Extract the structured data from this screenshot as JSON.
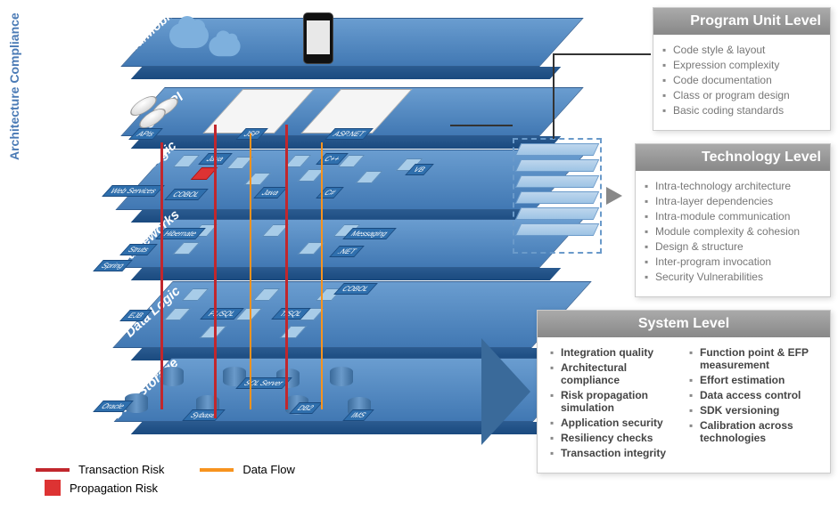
{
  "sideLabel": "Architecture Compliance",
  "layers": {
    "cloud": "Cloud/Mobile",
    "ui": "UI / API",
    "business": "Business Logic",
    "frameworks": "Frameworks",
    "datalogic": "Data Logic",
    "storage": "Data Storage"
  },
  "uiTech": {
    "apis": "APIs",
    "jsp": "JSP",
    "asp": "ASP.NET"
  },
  "businessTech": {
    "java_top": "Java",
    "cpp": "C++",
    "vb": "VB",
    "web": "Web Services",
    "cobol": "COBOL",
    "java2": "Java",
    "cs": "C#"
  },
  "frameworksTech": {
    "hibernate": "Hibernate",
    "messaging": "Messaging",
    "struts": "Struts",
    "net": ".NET",
    "spring": "Spring"
  },
  "dataLogicTech": {
    "cobol": "COBOL",
    "ejb": "EJB",
    "plsql": "PL/SQL",
    "tsql": "T/SQL"
  },
  "storageTech": {
    "oracle": "Oracle",
    "sqlserver": "SQL Server",
    "sybase": "Sybase",
    "db2": "DB2",
    "ims": "IMS"
  },
  "legend": {
    "transaction": "Transaction Risk",
    "dataflow": "Data Flow",
    "propagation": "Propagation Risk"
  },
  "panels": {
    "programUnit": {
      "title": "Program Unit Level",
      "items": [
        "Code style & layout",
        "Expression complexity",
        "Code documentation",
        "Class or program design",
        "Basic coding standards"
      ]
    },
    "technology": {
      "title": "Technology Level",
      "items": [
        "Intra-technology architecture",
        "Intra-layer dependencies",
        "Intra-module communication",
        "Module complexity & cohesion",
        "Design & structure",
        "Inter-program invocation",
        "Security Vulnerabilities"
      ]
    },
    "system": {
      "title": "System Level",
      "col1": [
        "Integration quality",
        "Architectural compliance",
        "Risk propagation simulation",
        "Application security",
        "Resiliency checks",
        "Transaction integrity"
      ],
      "col2": [
        "Function point & EFP measurement",
        "Effort estimation",
        "Data access control",
        "SDK versioning",
        "Calibration across technologies"
      ]
    }
  }
}
